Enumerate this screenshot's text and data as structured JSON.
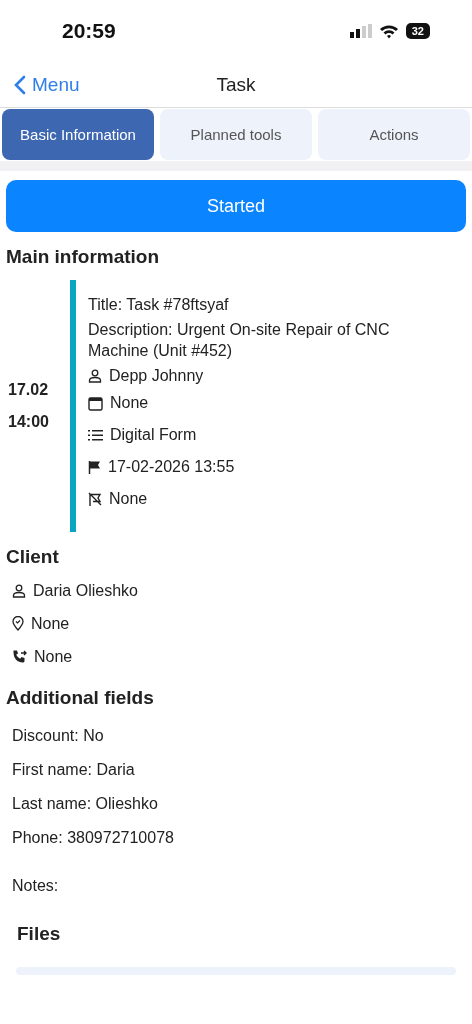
{
  "status_bar": {
    "time": "20:59",
    "battery": "32"
  },
  "nav": {
    "back": "Menu",
    "title": "Task"
  },
  "tabs": [
    {
      "label": "Basic Information",
      "selected": true
    },
    {
      "label": "Planned tools",
      "selected": false
    },
    {
      "label": "Actions",
      "selected": false
    }
  ],
  "status_button": "Started",
  "main": {
    "heading": "Main information",
    "date": "17.02",
    "time": "14:00",
    "lines": [
      "Title: Task #78ftsyaf",
      "Description: Urgent On-site Repair of CNC Machine (Unit #452)"
    ],
    "rows": [
      {
        "kind": "person",
        "text": "Depp Johnny"
      },
      {
        "kind": "calendar",
        "text": "None"
      },
      {
        "kind": "list",
        "text": "Digital Form"
      },
      {
        "kind": "flag",
        "text": "17-02-2026 13:55"
      },
      {
        "kind": "flag-off",
        "text": "None"
      }
    ]
  },
  "client": {
    "heading": "Client",
    "rows": [
      {
        "kind": "person",
        "text": "Daria Olieshko"
      },
      {
        "kind": "pin",
        "text": "None"
      },
      {
        "kind": "phone",
        "text": "None"
      }
    ]
  },
  "additional": {
    "heading": "Additional fields",
    "fields": [
      "Discount: No",
      "First name: Daria",
      "Last name: Olieshko",
      "Phone: 380972710078"
    ],
    "notes": "Notes:"
  },
  "files": {
    "heading": "Files"
  }
}
